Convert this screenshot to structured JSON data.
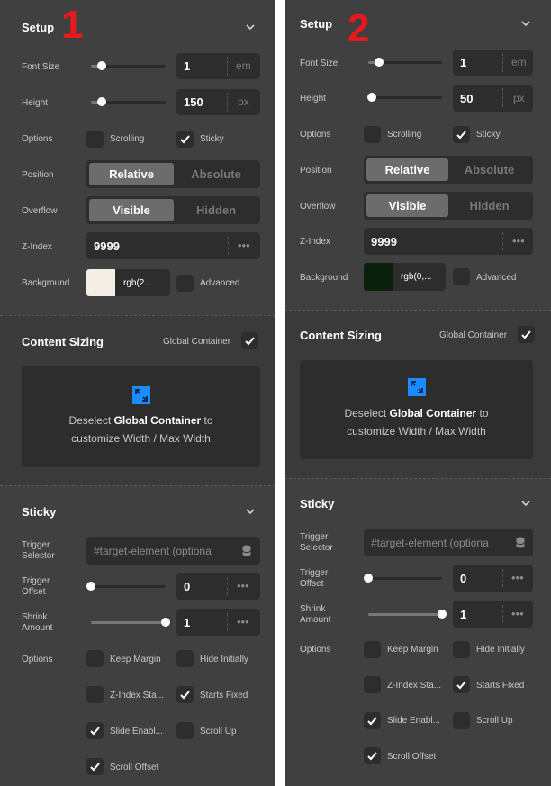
{
  "panels": [
    {
      "number": "1",
      "setup": {
        "title": "Setup",
        "font_size": {
          "label": "Font Size",
          "value": "1",
          "unit": "em"
        },
        "height": {
          "label": "Height",
          "value": "150",
          "unit": "px"
        },
        "options": {
          "label": "Options",
          "scrolling": "Scrolling",
          "scrolling_checked": false,
          "sticky": "Sticky",
          "sticky_checked": true
        },
        "position": {
          "label": "Position",
          "relative": "Relative",
          "absolute": "Absolute",
          "selected": "Relative"
        },
        "overflow": {
          "label": "Overflow",
          "visible": "Visible",
          "hidden": "Hidden",
          "selected": "Visible"
        },
        "zindex": {
          "label": "Z-Index",
          "value": "9999"
        },
        "background": {
          "label": "Background",
          "swatch_color": "#f3efe6",
          "value": "rgb(2...",
          "advanced": "Advanced",
          "advanced_checked": false
        }
      },
      "content_sizing": {
        "title": "Content Sizing",
        "global_container": "Global Container",
        "global_checked": true,
        "info_prefix": "Deselect ",
        "info_bold": "Global Container",
        "info_suffix": " to",
        "info_line2": "customize Width / Max Width"
      },
      "sticky": {
        "title": "Sticky",
        "trigger_selector": {
          "label_1": "Trigger",
          "label_2": "Selector",
          "placeholder": "#target-element (optiona"
        },
        "trigger_offset": {
          "label_1": "Trigger",
          "label_2": "Offset",
          "value": "0"
        },
        "shrink_amount": {
          "label_1": "Shrink",
          "label_2": "Amount",
          "value": "1"
        },
        "options_label": "Options",
        "keep_margin": "Keep Margin",
        "keep_margin_checked": false,
        "hide_initially": "Hide Initially",
        "hide_initially_checked": false,
        "zindex_sta": "Z-Index Sta...",
        "zindex_sta_checked": false,
        "starts_fixed": "Starts Fixed",
        "starts_fixed_checked": true,
        "slide_enabl": "Slide Enabl...",
        "slide_enabl_checked": true,
        "scroll_up": "Scroll Up",
        "scroll_up_checked": false,
        "scroll_offset": "Scroll Offset",
        "scroll_offset_checked": true
      }
    },
    {
      "number": "2",
      "setup": {
        "title": "Setup",
        "font_size": {
          "label": "Font Size",
          "value": "1",
          "unit": "em"
        },
        "height": {
          "label": "Height",
          "value": "50",
          "unit": "px"
        },
        "options": {
          "label": "Options",
          "scrolling": "Scrolling",
          "scrolling_checked": false,
          "sticky": "Sticky",
          "sticky_checked": true
        },
        "position": {
          "label": "Position",
          "relative": "Relative",
          "absolute": "Absolute",
          "selected": "Relative"
        },
        "overflow": {
          "label": "Overflow",
          "visible": "Visible",
          "hidden": "Hidden",
          "selected": "Visible"
        },
        "zindex": {
          "label": "Z-Index",
          "value": "9999"
        },
        "background": {
          "label": "Background",
          "swatch_color": "#0a1f0c",
          "value": "rgb(0,...",
          "advanced": "Advanced",
          "advanced_checked": false
        }
      },
      "content_sizing": {
        "title": "Content Sizing",
        "global_container": "Global Container",
        "global_checked": true,
        "info_prefix": "Deselect ",
        "info_bold": "Global Container",
        "info_suffix": " to",
        "info_line2": "customize Width / Max Width"
      },
      "sticky": {
        "title": "Sticky",
        "trigger_selector": {
          "label_1": "Trigger",
          "label_2": "Selector",
          "placeholder": "#target-element (optiona"
        },
        "trigger_offset": {
          "label_1": "Trigger",
          "label_2": "Offset",
          "value": "0"
        },
        "shrink_amount": {
          "label_1": "Shrink",
          "label_2": "Amount",
          "value": "1"
        },
        "options_label": "Options",
        "keep_margin": "Keep Margin",
        "keep_margin_checked": false,
        "hide_initially": "Hide Initially",
        "hide_initially_checked": false,
        "zindex_sta": "Z-Index Sta...",
        "zindex_sta_checked": false,
        "starts_fixed": "Starts Fixed",
        "starts_fixed_checked": true,
        "slide_enabl": "Slide Enabl...",
        "slide_enabl_checked": true,
        "scroll_up": "Scroll Up",
        "scroll_up_checked": false,
        "scroll_offset": "Scroll Offset",
        "scroll_offset_checked": true
      }
    }
  ],
  "colors": {
    "panel_bg": "#404040",
    "field_bg": "#2d2d2d",
    "accent_number": "#e8181f",
    "expand_icon": "#1a8cff"
  }
}
